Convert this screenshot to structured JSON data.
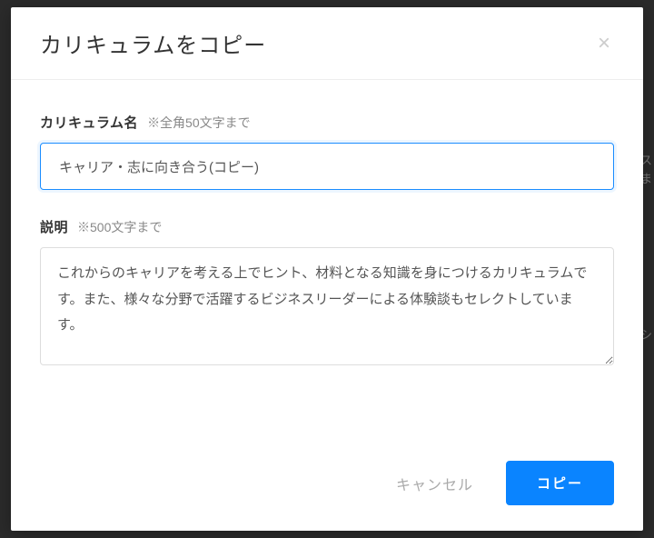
{
  "modal": {
    "title": "カリキュラムをコピー",
    "close_symbol": "×"
  },
  "fields": {
    "name": {
      "label": "カリキュラム名",
      "hint": "※全角50文字まで",
      "value": "キャリア・志に向き合う(コピー)"
    },
    "description": {
      "label": "説明",
      "hint": "※500文字まで",
      "value": "これからのキャリアを考える上でヒント、材料となる知識を身につけるカリキュラムです。また、様々な分野で活躍するビジネスリーダーによる体験談もセレクトしています。"
    }
  },
  "actions": {
    "cancel": "キャンセル",
    "submit": "コピー"
  },
  "backdrop": {
    "r1": "ス",
    "r2": "ま",
    "r3": "シ"
  }
}
